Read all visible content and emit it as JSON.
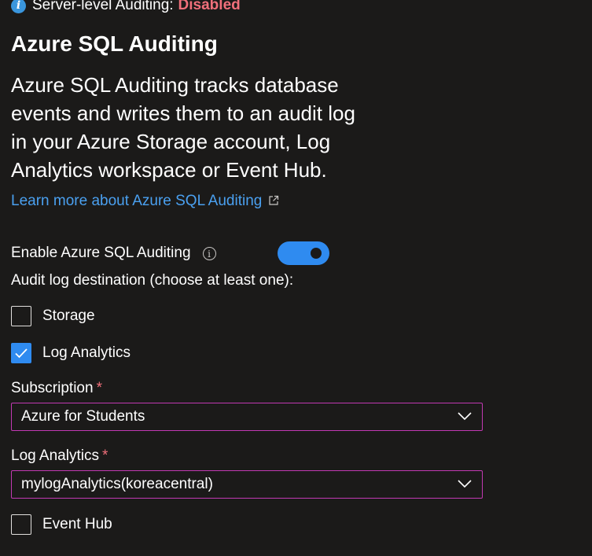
{
  "status": {
    "label": "Server-level Auditing:",
    "value": "Disabled",
    "icon": "info-icon",
    "value_color": "#f1707b"
  },
  "title": "Azure SQL Auditing",
  "description": {
    "text": "Azure SQL Auditing tracks database events and writes them to an audit log in your Azure Storage account, Log Analytics workspace or Event Hub.",
    "link_text": "Learn more about Azure SQL Auditing",
    "link_icon": "external-link-icon"
  },
  "enable_auditing": {
    "label": "Enable Azure SQL Auditing",
    "help_icon": "info-circle-icon",
    "toggle_on": true,
    "accent_color": "#2f8bf0"
  },
  "destination": {
    "label": "Audit log destination (choose at least one):",
    "storage": {
      "label": "Storage",
      "checked": false
    },
    "log_analytics": {
      "label": "Log Analytics",
      "checked": true
    },
    "event_hub": {
      "label": "Event Hub",
      "checked": false
    }
  },
  "subscription": {
    "label": "Subscription",
    "required_mark": "*",
    "value": "Azure for Students"
  },
  "log_analytics_workspace": {
    "label": "Log Analytics",
    "required_mark": "*",
    "value": "mylogAnalytics(koreacentral)"
  }
}
